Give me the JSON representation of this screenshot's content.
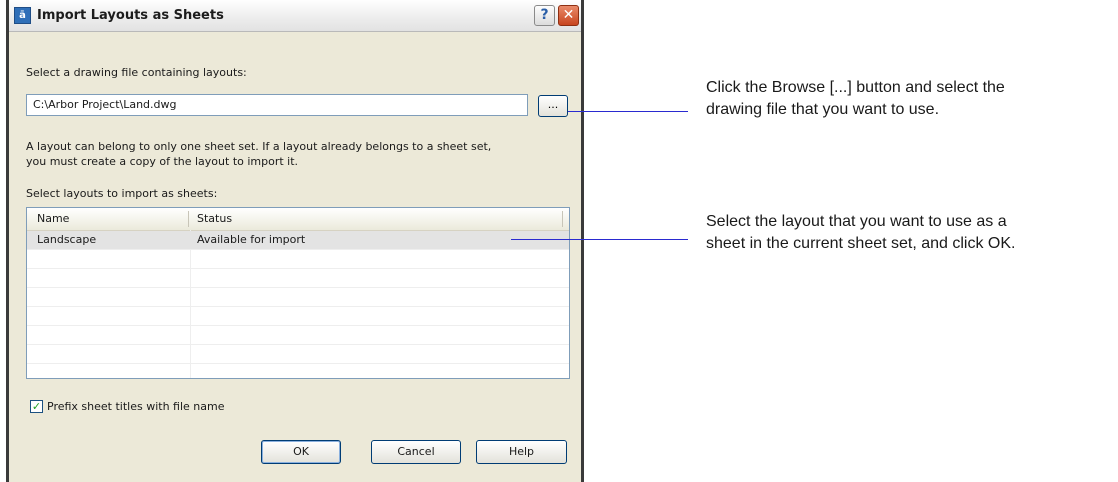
{
  "window": {
    "title": "Import Layouts as Sheets",
    "app_icon": "autocad-icon",
    "help_button": "?",
    "close_button": "✕"
  },
  "drawing_file": {
    "label": "Select a drawing file containing layouts:",
    "value": "C:\\Arbor Project\\Land.dwg",
    "browse_label": "..."
  },
  "info": {
    "line1": "A layout can belong to only one sheet set. If a layout already belongs to a sheet set,",
    "line2": "you must create a copy of the layout to import it."
  },
  "layouts": {
    "label": "Select layouts to import as sheets:",
    "columns": [
      "Name",
      "Status"
    ],
    "rows": [
      {
        "name": "Landscape",
        "status": "Available for import"
      }
    ]
  },
  "prefix": {
    "checked": true,
    "label": "Prefix sheet titles with file name"
  },
  "buttons": {
    "ok": "OK",
    "cancel": "Cancel",
    "help": "Help"
  },
  "callouts": {
    "browse_line1": "Click the Browse [...] button and select the",
    "browse_line2": "drawing file that you want to use.",
    "layout_line1": "Select the layout that you want to use as a",
    "layout_line2": "sheet in the current sheet set, and click OK."
  },
  "colors": {
    "dialog_bg": "#ece9d8",
    "callout_line": "#2a2ad0",
    "selected_row": "#e3e3e3"
  }
}
